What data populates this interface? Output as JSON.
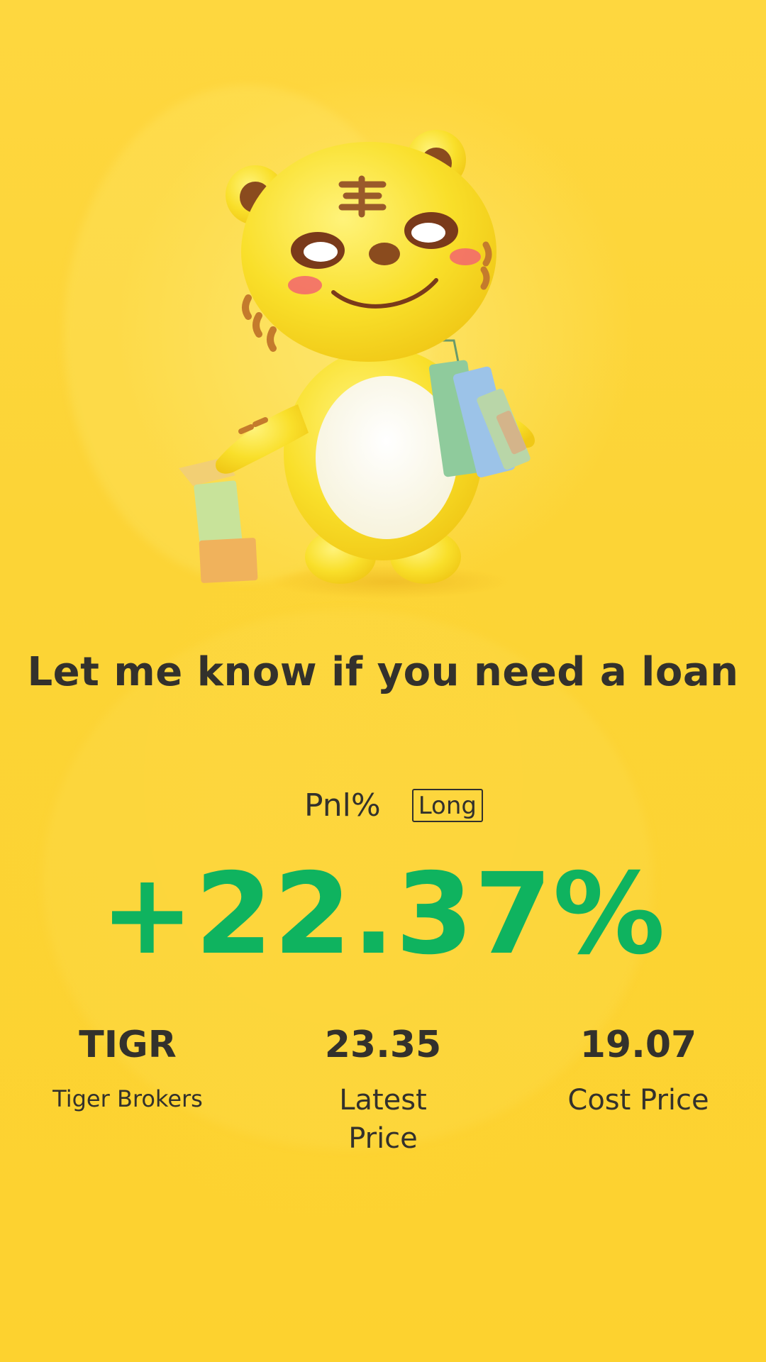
{
  "headline": "Let me know if you need a loan",
  "pnl": {
    "label": "Pnl%",
    "position_badge": "Long",
    "value": "+22.37%",
    "value_color": "#0fb35f"
  },
  "stats": [
    {
      "value": "TIGR",
      "label": "Tiger Brokers"
    },
    {
      "value": "23.35",
      "label": "Latest Price"
    },
    {
      "value": "19.07",
      "label": "Cost Price"
    }
  ],
  "colors": {
    "background": "#fdd43a",
    "text": "#33312c",
    "positive": "#0fb35f"
  },
  "mascot": {
    "icon": "tiger-mascot-with-shopping-bags-icon"
  }
}
